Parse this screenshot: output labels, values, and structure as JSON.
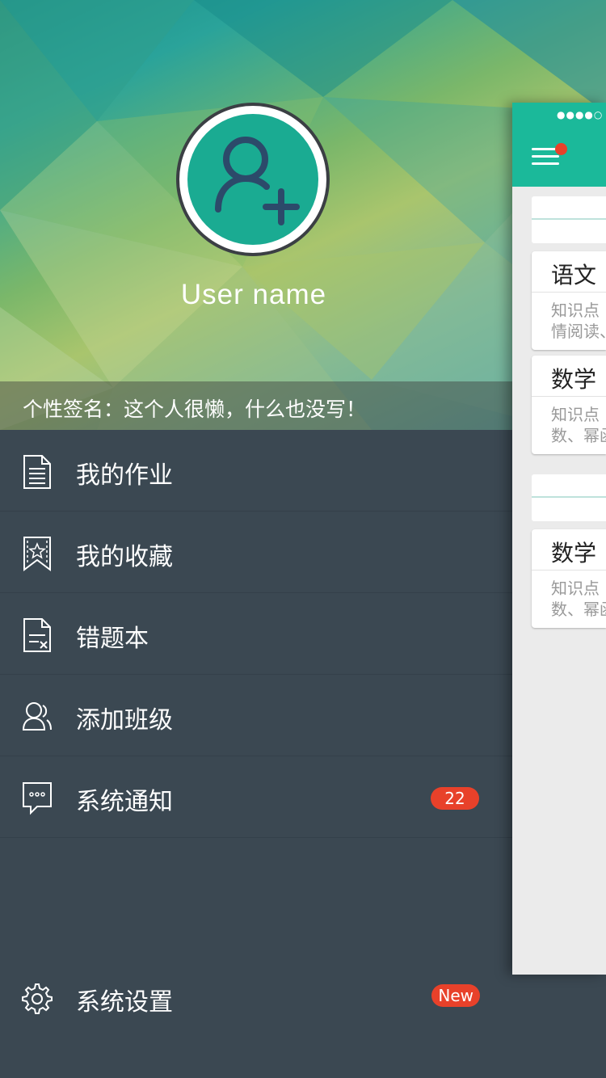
{
  "profile": {
    "username": "User name",
    "signature": "个性签名：这个人很懒，什么也没写！"
  },
  "menu": {
    "items": [
      {
        "label": "我的作业",
        "icon": "document-icon"
      },
      {
        "label": "我的收藏",
        "icon": "bookmark-star-icon"
      },
      {
        "label": "错题本",
        "icon": "error-book-icon"
      },
      {
        "label": "添加班级",
        "icon": "users-icon"
      },
      {
        "label": "系统通知",
        "icon": "message-icon",
        "badge": "22"
      }
    ],
    "settings": {
      "label": "系统设置",
      "icon": "gear-icon",
      "badge": "New"
    }
  },
  "main_preview": {
    "status_dots": "●●●●○",
    "cards": [
      {
        "subject": "语文",
        "desc_line1": "知识点",
        "desc_line2": "情阅读、"
      },
      {
        "subject": "数学",
        "desc_line1": "知识点",
        "desc_line2": "数、幂函"
      },
      {
        "subject": "数学",
        "desc_line1": "知识点",
        "desc_line2": "数、幂函"
      }
    ]
  },
  "colors": {
    "accent": "#1bb99a",
    "drawer_bg": "#3b4852",
    "badge_red": "#e8412a",
    "avatar_green": "#1aab92"
  }
}
